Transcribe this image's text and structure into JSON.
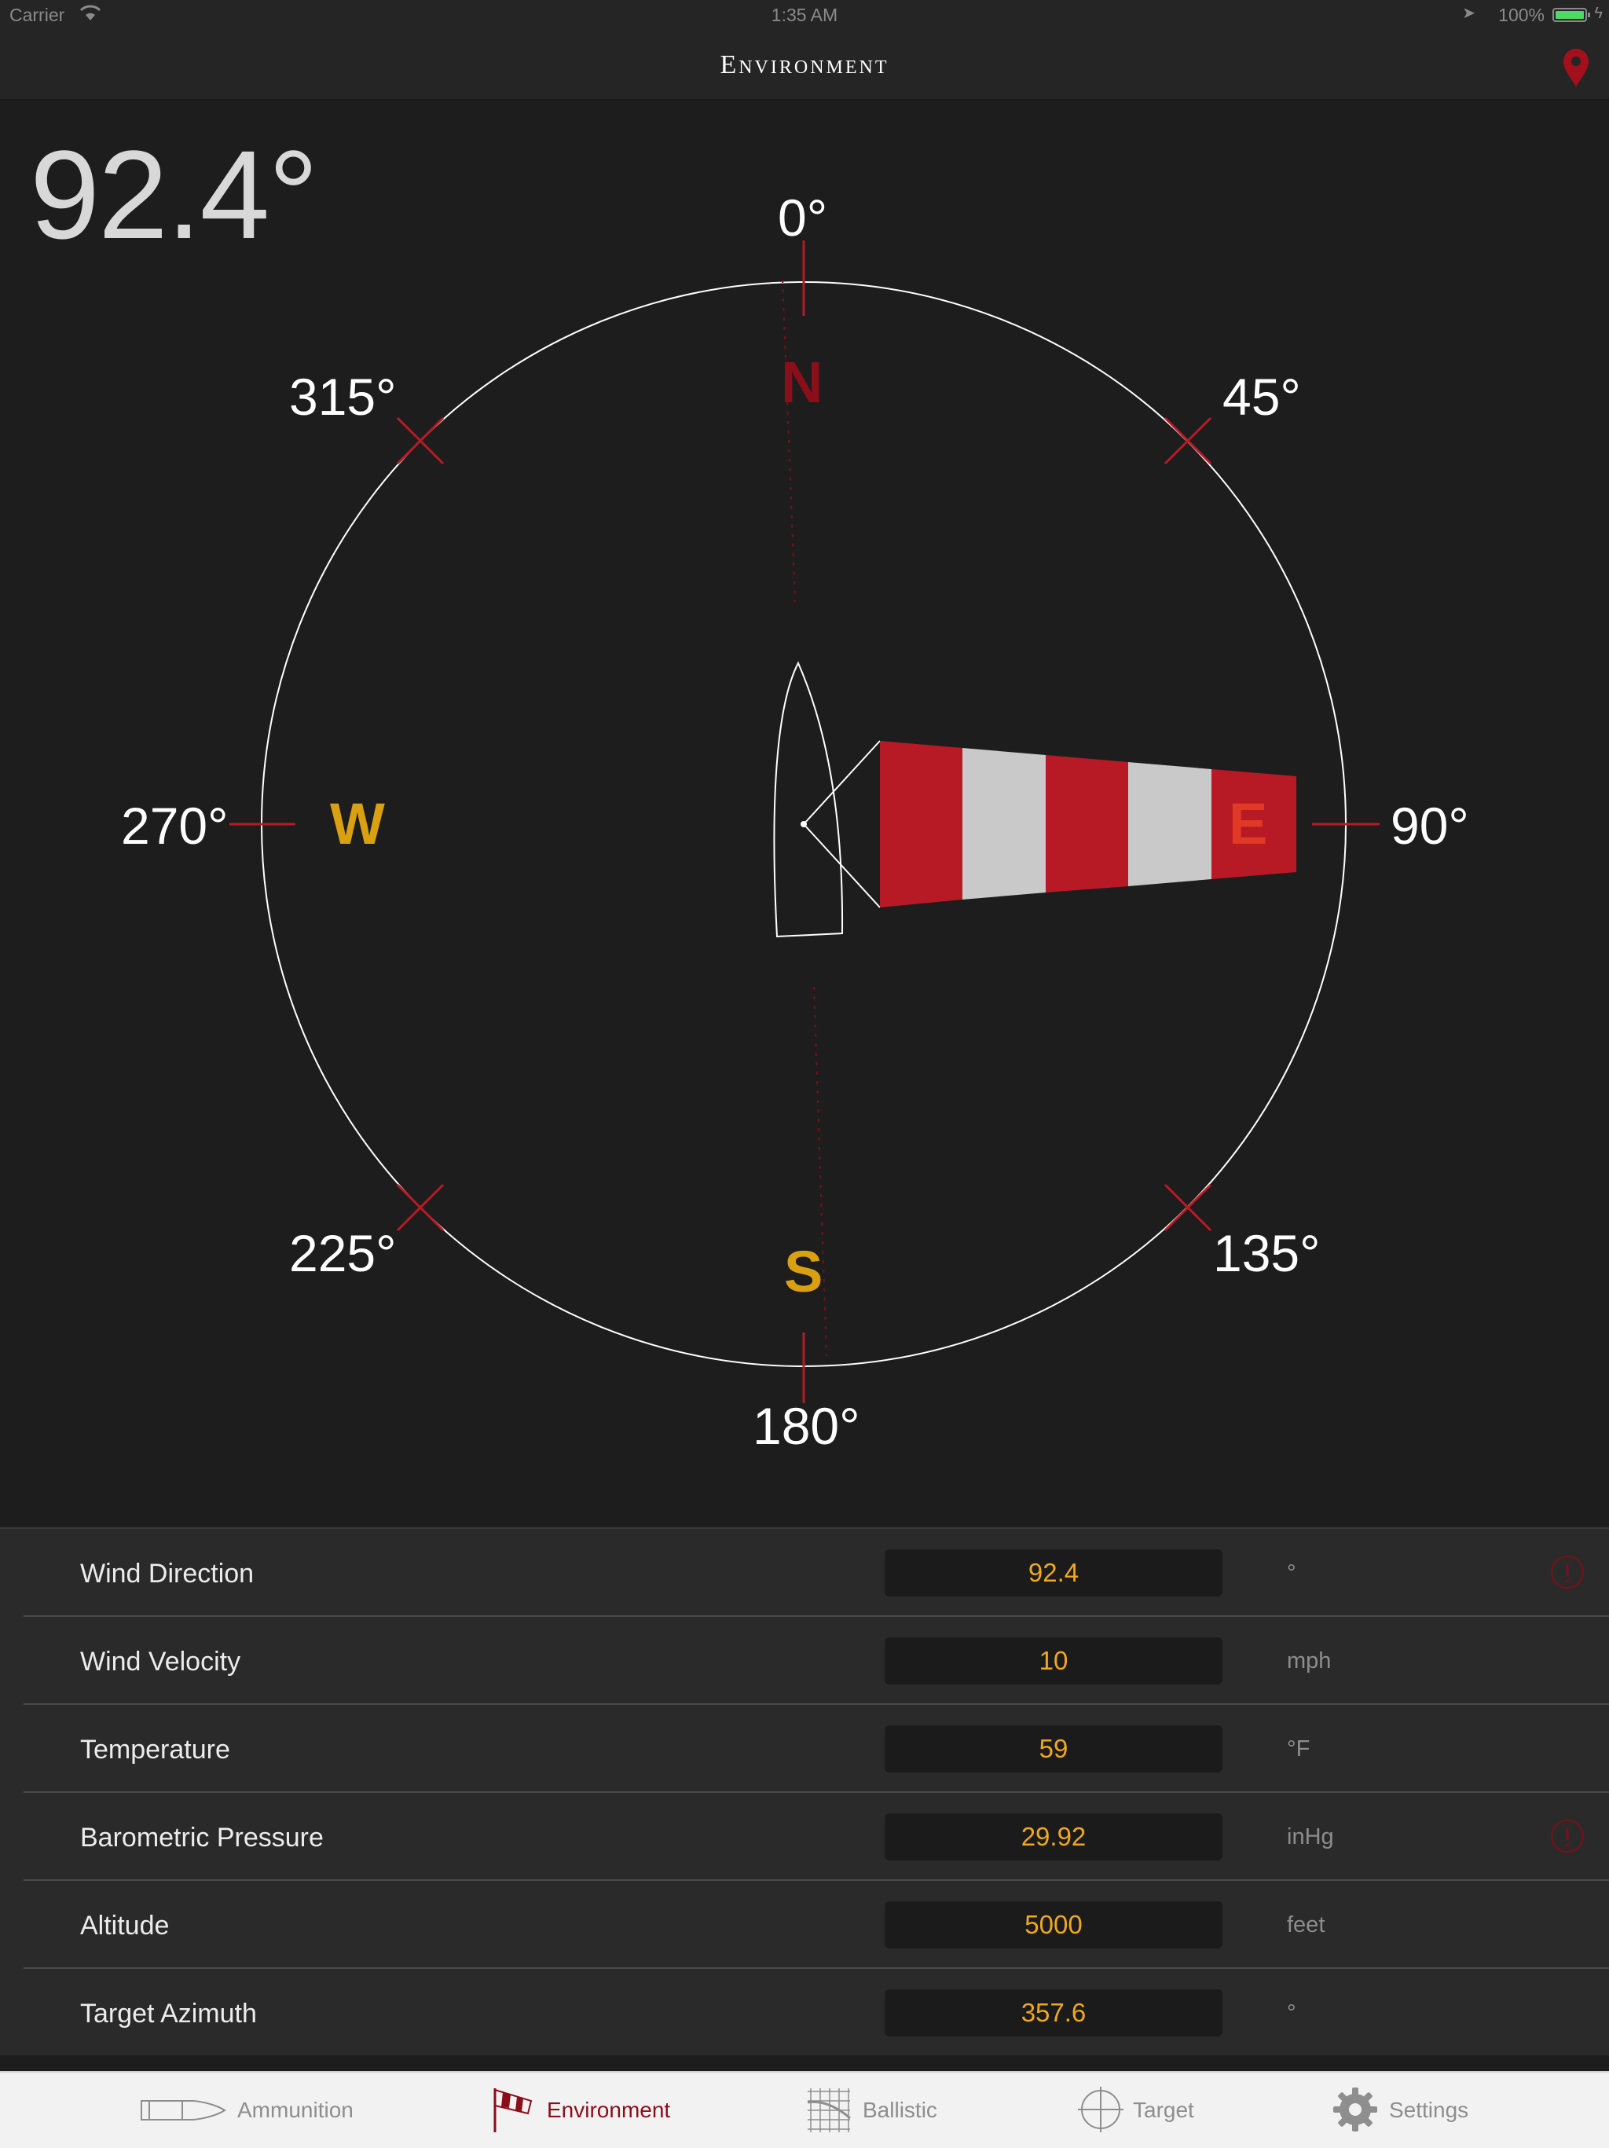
{
  "status_bar": {
    "carrier": "Carrier",
    "time": "1:35 AM",
    "battery": "100%"
  },
  "nav": {
    "title": "Environment",
    "location_icon": "map-pin-icon"
  },
  "heading_readout": "92.4°",
  "compass": {
    "degree_labels": {
      "n": "0°",
      "ne": "45°",
      "e": "90°",
      "se": "135°",
      "s": "180°",
      "sw": "225°",
      "w": "270°",
      "nw": "315°"
    },
    "cardinals": {
      "n": "N",
      "e": "E",
      "s": "S",
      "w": "W"
    },
    "wind_direction_deg": 92.4,
    "colors": {
      "north": "#8b0e1a",
      "east": "#e03a26",
      "south_west": "#d9a012",
      "sock_red": "#b81a25",
      "sock_white": "#c9c9c9"
    }
  },
  "rows": [
    {
      "label": "Wind Direction",
      "value": "92.4",
      "unit": "°",
      "info": true
    },
    {
      "label": "Wind Velocity",
      "value": "10",
      "unit": "mph",
      "info": false
    },
    {
      "label": "Temperature",
      "value": "59",
      "unit": "°F",
      "info": false
    },
    {
      "label": "Barometric Pressure",
      "value": "29.92",
      "unit": "inHg",
      "info": true
    },
    {
      "label": "Altitude",
      "value": "5000",
      "unit": "feet",
      "info": false
    },
    {
      "label": "Target Azimuth",
      "value": "357.6",
      "unit": "°",
      "info": false
    }
  ],
  "tabs": [
    {
      "label": "Ammunition",
      "icon": "bullet-icon",
      "active": false
    },
    {
      "label": "Environment",
      "icon": "windsock-icon",
      "active": true
    },
    {
      "label": "Ballistic",
      "icon": "ballistic-grid-icon",
      "active": false
    },
    {
      "label": "Target",
      "icon": "crosshair-icon",
      "active": false
    },
    {
      "label": "Settings",
      "icon": "gear-icon",
      "active": false
    }
  ]
}
